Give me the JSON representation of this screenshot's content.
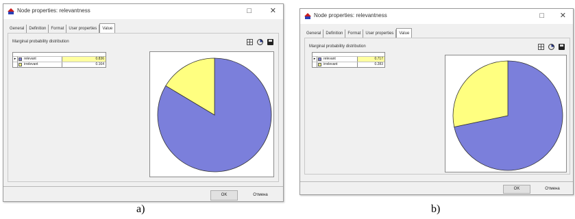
{
  "dialogs": [
    {
      "title": "Node properties: relevantness",
      "tabs": [
        "General",
        "Definition",
        "Format",
        "User properties",
        "Value"
      ],
      "active_tab": "Value",
      "panel_label": "Marginal probability distribution",
      "states": [
        {
          "name": "relevant",
          "value": "0.836",
          "color": "#7b7fdb"
        },
        {
          "name": "irrelevant",
          "value": "0.164",
          "color": "#ffff80"
        }
      ],
      "buttons": {
        "ok": "OK",
        "cancel": "Отмена"
      },
      "caption": "a)"
    },
    {
      "title": "Node properties: relevantness",
      "tabs": [
        "General",
        "Definition",
        "Format",
        "User properties",
        "Value"
      ],
      "active_tab": "Value",
      "panel_label": "Marginal probability distribution",
      "states": [
        {
          "name": "relevant",
          "value": "0.717",
          "color": "#7b7fdb"
        },
        {
          "name": "irrelevant",
          "value": "0.283",
          "color": "#ffff80"
        }
      ],
      "buttons": {
        "ok": "OK",
        "cancel": "Отмена"
      },
      "caption": "b)"
    }
  ]
}
